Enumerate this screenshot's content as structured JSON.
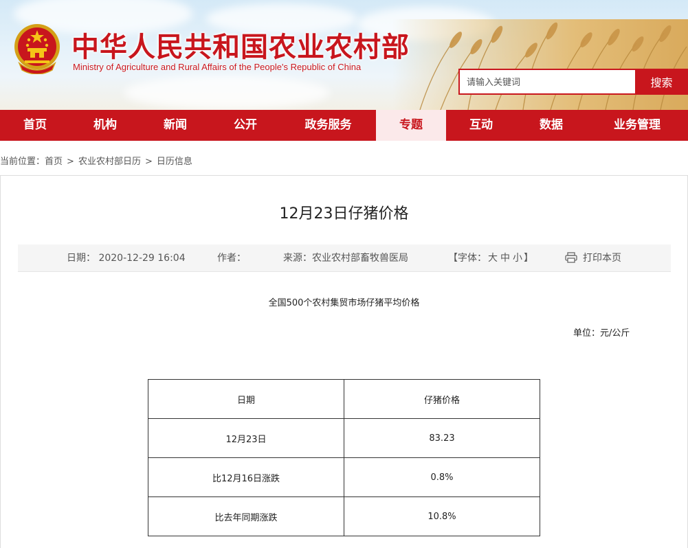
{
  "header": {
    "title_cn": "中华人民共和国农业农村部",
    "title_en": "Ministry of Agriculture and Rural Affairs of the People's Republic of China",
    "emblem_icon": "national-emblem-icon",
    "search": {
      "placeholder": "请输入关键词",
      "button_label": "搜索"
    },
    "brand_color": "#c8161d"
  },
  "nav": {
    "items": [
      {
        "label": "首页"
      },
      {
        "label": "机构"
      },
      {
        "label": "新闻"
      },
      {
        "label": "公开"
      },
      {
        "label": "政务服务"
      },
      {
        "label": "专题"
      },
      {
        "label": "互动"
      },
      {
        "label": "数据"
      },
      {
        "label": "业务管理"
      }
    ],
    "active_index": 5,
    "active_bg": "#fbe9ea"
  },
  "breadcrumb": {
    "prefix": "当前位置：",
    "items": [
      "首页",
      "农业农村部日历",
      "日历信息"
    ],
    "separator": ">"
  },
  "article": {
    "title": "12月23日仔猪价格",
    "meta": {
      "date_label": "日期：",
      "date_value": "2020-12-29 16:04",
      "author_label": "作者：",
      "author_value": "",
      "source_label": "来源：",
      "source_value": "农业农村部畜牧兽医局",
      "font_prefix": "【字体：",
      "font_sizes": [
        "大",
        "中",
        "小"
      ],
      "font_suffix": "】",
      "print_label": "打印本页",
      "print_icon": "printer-icon"
    },
    "table_caption": "全国500个农村集贸市场仔猪平均价格",
    "unit": "单位：元/公斤",
    "table": {
      "headers": [
        "日期",
        "仔猪价格"
      ],
      "rows": [
        [
          "12月23日",
          "83.23"
        ],
        [
          "比12月16日涨跌",
          "0.8%"
        ],
        [
          "比去年同期涨跌",
          "10.8%"
        ]
      ]
    }
  }
}
